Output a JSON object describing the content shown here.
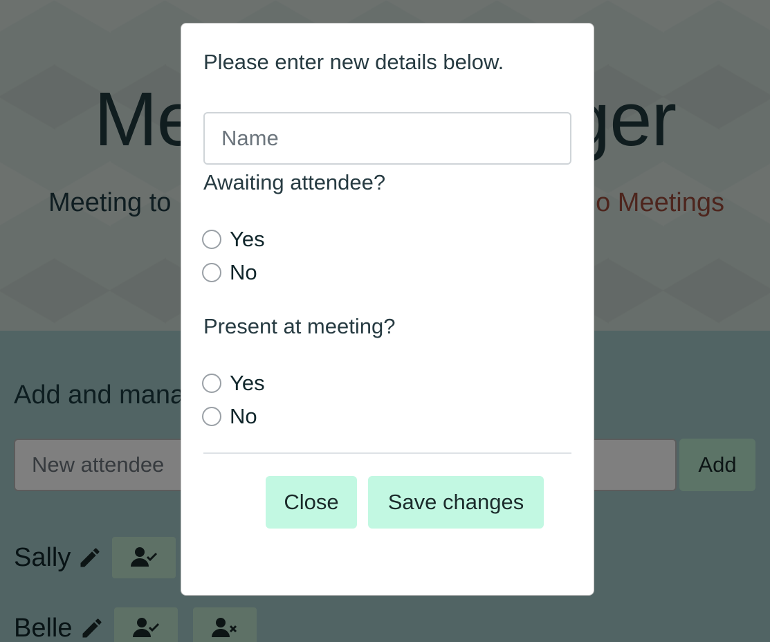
{
  "hero": {
    "title": "Meeting Manager",
    "subtitle": "Meeting to",
    "link_text": "o Meetings"
  },
  "main": {
    "section_heading": "Add and manage attendees",
    "attendee_input_placeholder": "New attendee",
    "add_button_label": "Add",
    "attendees": [
      {
        "name": "Sally"
      },
      {
        "name": "Belle"
      }
    ]
  },
  "modal": {
    "intro": "Please enter new details below.",
    "name_placeholder": "Name",
    "awaiting_question": "Awaiting attendee?",
    "awaiting_options": [
      "Yes",
      "No"
    ],
    "present_question": "Present at meeting?",
    "present_options": [
      "Yes",
      "No"
    ],
    "close_label": "Close",
    "save_label": "Save changes"
  },
  "colors": {
    "button_accent": "#c2f8e2",
    "link": "#9a4a3a",
    "text_dark": "#273b42"
  },
  "icons": {
    "edit": "pencil-icon",
    "user_check": "user-check-icon",
    "user_remove": "user-times-icon"
  }
}
